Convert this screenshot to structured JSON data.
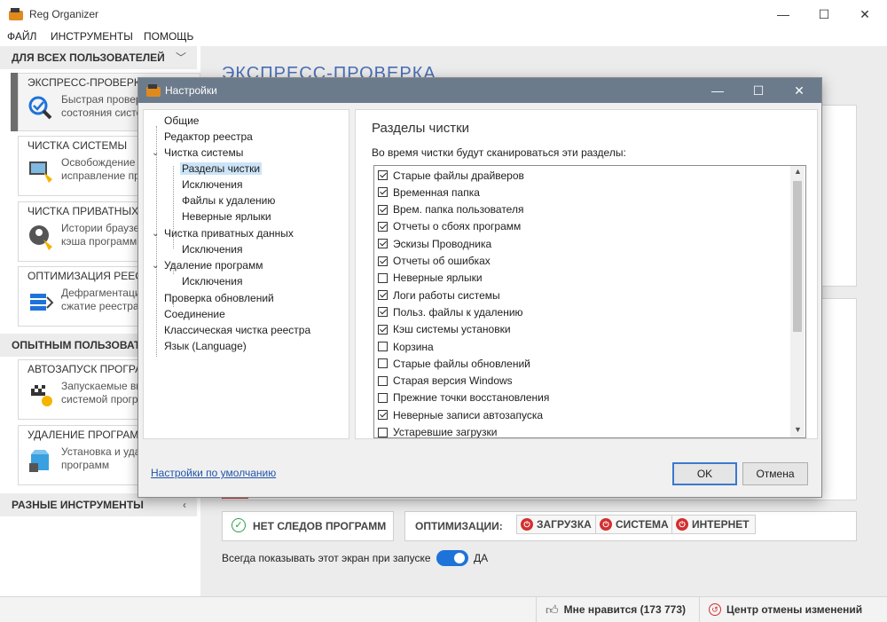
{
  "window": {
    "title": "Reg Organizer"
  },
  "menu": {
    "file": "ФАЙЛ",
    "tools": "ИНСТРУМЕНТЫ",
    "help": "ПОМОЩЬ"
  },
  "sidebar": {
    "group_all_users": "ДЛЯ ВСЕХ ПОЛЬЗОВАТЕЛЕЙ",
    "group_advanced": "ОПЫТНЫМ ПОЛЬЗОВАТ",
    "group_misc": "РАЗНЫЕ ИНСТРУМЕНТЫ",
    "items": [
      {
        "title": "ЭКСПРЕСС-ПРОВЕРКА",
        "desc": "Быстрая провер\nсостояния систе"
      },
      {
        "title": "ЧИСТКА СИСТЕМЫ",
        "desc": "Освобождение\nисправление пр"
      },
      {
        "title": "ЧИСТКА ПРИВАТНЫХ",
        "desc": "Истории браузе\nкэша программ"
      },
      {
        "title": "ОПТИМИЗАЦИЯ РЕЕС",
        "desc": "Дефрагментаци\nсжатие реестра"
      },
      {
        "title": "АВТОЗАПУСК ПРОГРА",
        "desc": "Запускаемые вм\nсистемой прогр"
      },
      {
        "title": "УДАЛЕНИЕ ПРОГРАМ",
        "desc": "Установка и уда\nпрограмм"
      }
    ]
  },
  "content": {
    "title": "ЭКСПРЕСС-ПРОВЕРКА",
    "no_traces": "НЕТ СЛЕДОВ ПРОГРАММ",
    "optimizations_label": "ОПТИМИЗАЦИИ:",
    "opt_buttons": [
      "ЗАГРУЗКА",
      "СИСТЕМА",
      "ИНТЕРНЕТ"
    ],
    "startup_text": "Всегда показывать этот экран при запуске",
    "toggle_value": "ДА"
  },
  "bottom": {
    "like": "Мне нравится (173 773)",
    "undo_center": "Центр отмены изменений"
  },
  "dialog": {
    "title": "Настройки",
    "tree": [
      "Общие",
      "Редактор реестра",
      "Чистка системы",
      "Разделы чистки",
      "Исключения",
      "Файлы к удалению",
      "Неверные ярлыки",
      "Чистка приватных данных",
      "Исключения",
      "Удаление программ",
      "Исключения",
      "Проверка обновлений",
      "Соединение",
      "Классическая чистка реестра",
      "Язык (Language)"
    ],
    "panel_title": "Разделы чистки",
    "panel_subtitle": "Во время чистки будут сканироваться эти разделы:",
    "items": [
      {
        "label": "Старые файлы драйверов",
        "checked": true
      },
      {
        "label": "Временная папка",
        "checked": true
      },
      {
        "label": "Врем. папка пользователя",
        "checked": true
      },
      {
        "label": "Отчеты о сбоях программ",
        "checked": true
      },
      {
        "label": "Эскизы Проводника",
        "checked": true
      },
      {
        "label": "Отчеты об ошибках",
        "checked": true
      },
      {
        "label": "Неверные ярлыки",
        "checked": false
      },
      {
        "label": "Логи работы системы",
        "checked": true
      },
      {
        "label": "Польз. файлы к удалению",
        "checked": true
      },
      {
        "label": "Кэш системы установки",
        "checked": true
      },
      {
        "label": "Корзина",
        "checked": false
      },
      {
        "label": "Старые файлы обновлений",
        "checked": false
      },
      {
        "label": "Старая версия Windows",
        "checked": false
      },
      {
        "label": "Прежние точки восстановления",
        "checked": false
      },
      {
        "label": "Неверные записи автозапуска",
        "checked": true
      },
      {
        "label": "Устаревшие загрузки",
        "checked": false
      }
    ],
    "defaults_link": "Настройки по умолчанию",
    "ok": "OK",
    "cancel": "Отмена"
  },
  "colors": {
    "accent": "#4a6fb6",
    "dialog_title": "#6b7b8b",
    "toggle": "#1e73d9",
    "danger": "#d32f2f",
    "ok_border": "#3b78d0"
  }
}
